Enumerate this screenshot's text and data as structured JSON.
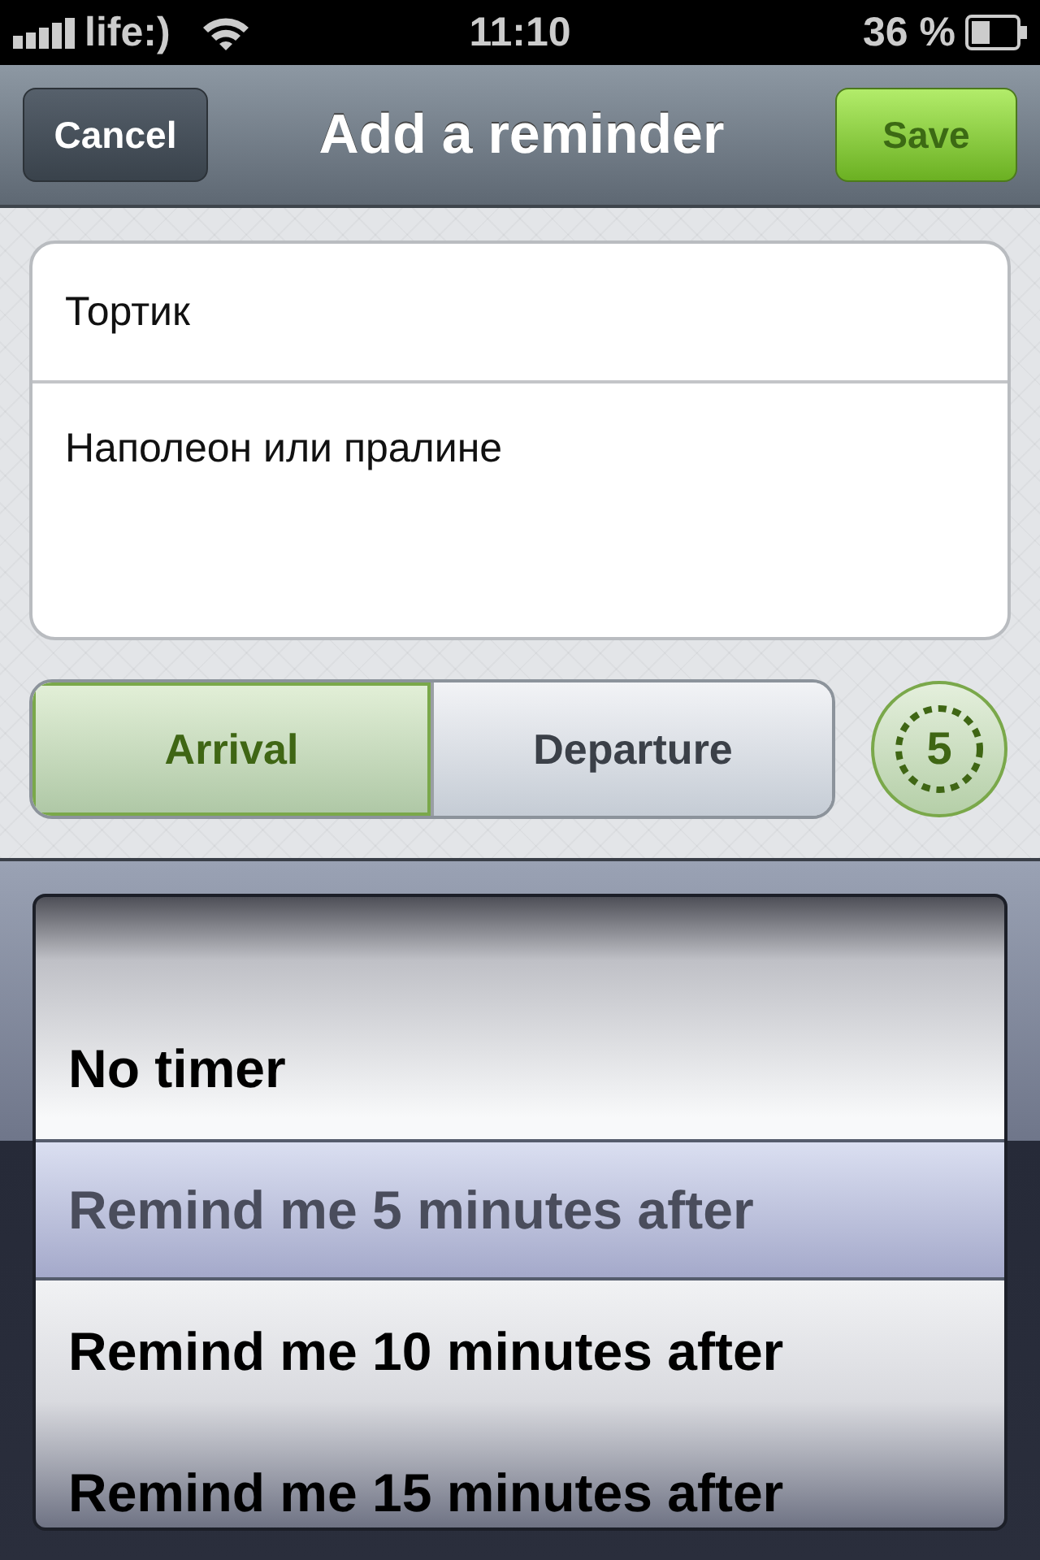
{
  "status_bar": {
    "carrier": "life:)",
    "time": "11:10",
    "battery": "36 %"
  },
  "nav_bar": {
    "title": "Add a reminder",
    "left_button": "Cancel",
    "right_button": "Save"
  },
  "form": {
    "title_field": {
      "value": "Тортик"
    },
    "notes_field": {
      "value": "Наполеон или пралине"
    }
  },
  "mode_tabs": [
    {
      "label": "Arrival",
      "selected": true
    },
    {
      "label": "Departure",
      "selected": false
    }
  ],
  "timer_badge": "5",
  "timer_picker": {
    "options": [
      {
        "label": "No timer",
        "selected": false
      },
      {
        "label": "Remind me 5 minutes after",
        "selected": true
      },
      {
        "label": "Remind me 10 minutes after",
        "selected": false
      },
      {
        "label": "Remind me 15 minutes after",
        "selected": false
      }
    ]
  }
}
